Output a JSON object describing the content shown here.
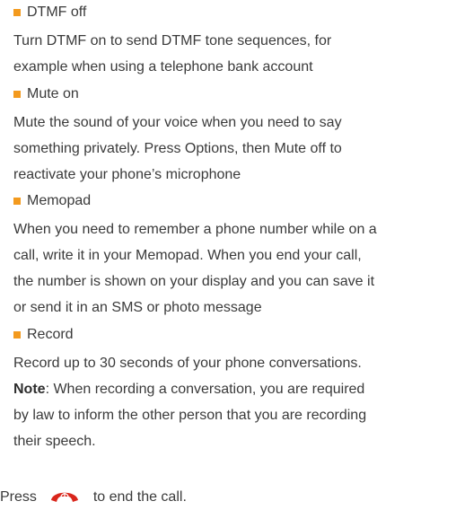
{
  "items": [
    {
      "title": "DTMF off",
      "lines": [
        "Turn DTMF on to send DTMF tone sequences, for",
        "example when using a telephone bank account"
      ]
    },
    {
      "title": "Mute on",
      "lines": [
        "Mute the sound of your voice when you need to say",
        "something privately. Press Options, then Mute off to",
        "reactivate your phone’s microphone"
      ]
    },
    {
      "title": "Memopad",
      "lines": [
        "When you need to remember a phone number while on a",
        "call, write it in your Memopad. When you end your call,",
        "the number is shown on your display and you can save it",
        "or send it in an SMS or photo message"
      ]
    },
    {
      "title": "Record",
      "lines": [
        "Record up to 30 seconds of your phone conversations."
      ],
      "note_label": "Note",
      "note_lines": [
        ": When recording a conversation, you are required",
        "by law to inform the other person that you are recording",
        "their speech."
      ]
    }
  ],
  "footer": {
    "prefix": "Press",
    "icon": "end-call-icon",
    "suffix": "to end the call."
  },
  "colors": {
    "bullet": "#f39a1e",
    "end_call_icon": "#d9261c",
    "text": "#3a3a3a"
  }
}
